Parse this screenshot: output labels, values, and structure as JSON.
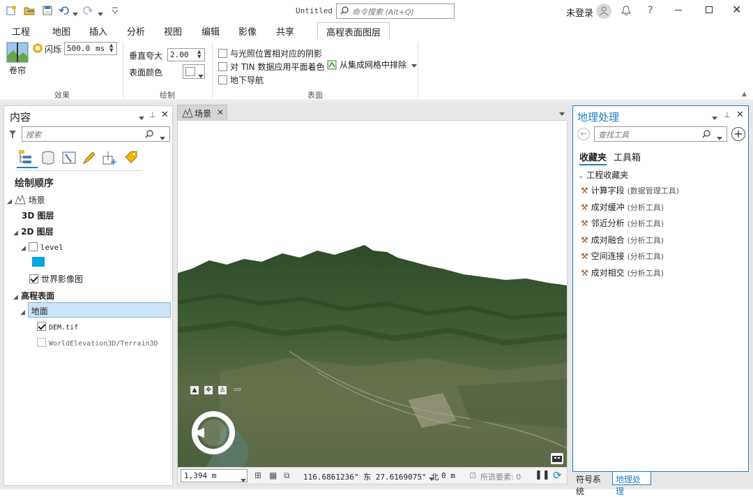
{
  "window": {
    "title": "Untitled",
    "command_search_placeholder": "命令搜索 (Alt+Q)",
    "user_label": "未登录"
  },
  "ribbon_tabs": [
    "工程",
    "地图",
    "插入",
    "分析",
    "视图",
    "编辑",
    "影像",
    "共享",
    "高程表面图层"
  ],
  "ribbon": {
    "effects": {
      "group_label": "效果",
      "swipe_label": "卷帘",
      "flicker_label": "闪烁",
      "flicker_value": "500.0",
      "flicker_unit": "ms"
    },
    "drawing": {
      "group_label": "绘制",
      "vertical_exaggeration_label": "垂直夸大",
      "vertical_exaggeration_value": "2.00",
      "surface_color_label": "表面颜色"
    },
    "surface": {
      "group_label": "表面",
      "option1": "与光照位置相对应的阴影",
      "option2": "对 TIN 数据应用平面着色",
      "option3": "地下导航",
      "exclude_label": "从集成网格中排除"
    }
  },
  "contents": {
    "title": "内容",
    "search_placeholder": "搜索",
    "drawing_order": "绘制顺序",
    "tree": {
      "scene": "场景",
      "layers_3d": "3D 图层",
      "layers_2d": "2D 图层",
      "level": "level",
      "imagery": "世界影像图",
      "elevation_surfaces": "高程表面",
      "ground": "地面",
      "dem": "DEM.tif",
      "terrain": "WorldElevation3D/Terrain3D"
    }
  },
  "view": {
    "tab_label": "场景",
    "scale": "1,394 m",
    "coords": "116.6861236° 东 27.6169075° 北",
    "elevation": "0 m",
    "selected_features": "所选要素: 0"
  },
  "geoprocessing": {
    "title": "地理处理",
    "search_placeholder": "查找工具",
    "tab_favorites": "收藏夹",
    "tab_toolboxes": "工具箱",
    "project_favorites": "工程收藏夹",
    "tools": [
      {
        "name": "计算字段",
        "toolbox": "(数据管理工具)"
      },
      {
        "name": "成对缓冲",
        "toolbox": "(分析工具)"
      },
      {
        "name": "邻近分析",
        "toolbox": "(分析工具)"
      },
      {
        "name": "成对融合",
        "toolbox": "(分析工具)"
      },
      {
        "name": "空间连接",
        "toolbox": "(分析工具)"
      },
      {
        "name": "成对相交",
        "toolbox": "(分析工具)"
      }
    ]
  },
  "bottom_tabs": [
    "符号系统",
    "地理处理"
  ],
  "colors": {
    "accent": "#1a7fc1",
    "selection_bg": "#cce4f7",
    "level_swatch": "#0aa3e0"
  }
}
